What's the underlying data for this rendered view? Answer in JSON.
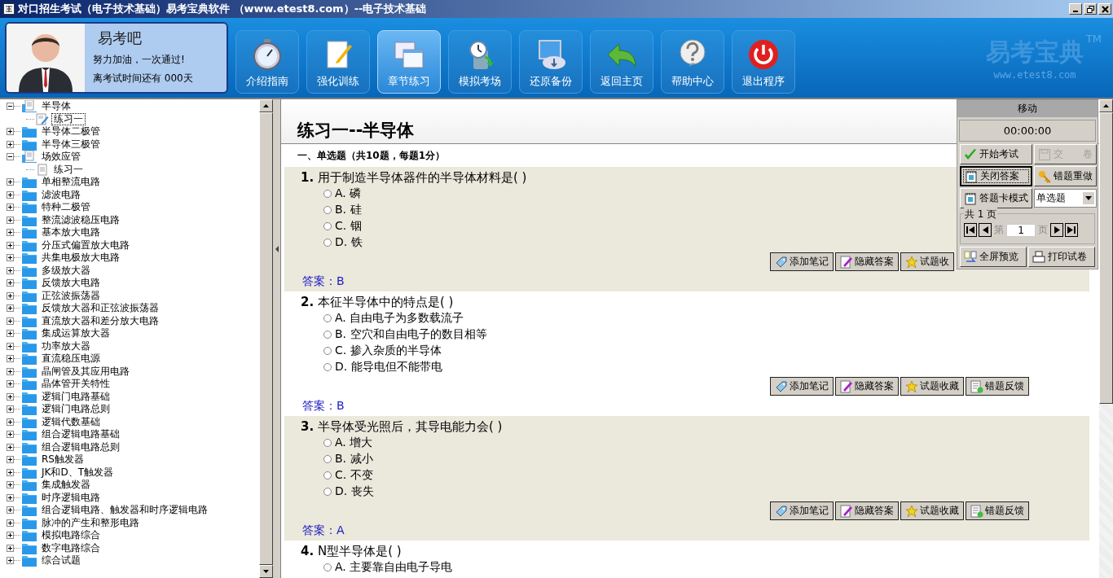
{
  "window": {
    "title": "对口招生考试（电子技术基础）易考宝典软件 （www.etest8.com）--电子技术基础"
  },
  "profile": {
    "name": "易考吧",
    "slogan": "努力加油，一次通过!",
    "countdown": "离考试时间还有 000天"
  },
  "nav": [
    {
      "label": "介绍指南",
      "selected": false
    },
    {
      "label": "强化训练",
      "selected": false
    },
    {
      "label": "章节练习",
      "selected": true
    },
    {
      "label": "模拟考场",
      "selected": false
    },
    {
      "label": "还原备份",
      "selected": false
    },
    {
      "label": "返回主页",
      "selected": false
    },
    {
      "label": "帮助中心",
      "selected": false
    },
    {
      "label": "退出程序",
      "selected": false
    }
  ],
  "logo": {
    "name": "易考宝典",
    "mark": "TM",
    "url": "www.etest8.com"
  },
  "tree": [
    {
      "label": "半导体",
      "expanded": true,
      "children": [
        {
          "label": "练习一",
          "selected": true
        }
      ]
    },
    {
      "label": "半导体二极管",
      "expanded": false
    },
    {
      "label": "半导体三极管",
      "expanded": false
    },
    {
      "label": "场效应管",
      "expanded": true,
      "children": [
        {
          "label": "练习一",
          "selected": false
        }
      ]
    },
    {
      "label": "单相整流电路",
      "expanded": false
    },
    {
      "label": "滤波电路",
      "expanded": false
    },
    {
      "label": "特种二极管",
      "expanded": false
    },
    {
      "label": "整流滤波稳压电路",
      "expanded": false
    },
    {
      "label": "基本放大电路",
      "expanded": false
    },
    {
      "label": "分压式偏置放大电路",
      "expanded": false
    },
    {
      "label": "共集电极放大电路",
      "expanded": false
    },
    {
      "label": "多级放大器",
      "expanded": false
    },
    {
      "label": "反馈放大电路",
      "expanded": false
    },
    {
      "label": "正弦波振荡器",
      "expanded": false
    },
    {
      "label": "反馈放大器和正弦波振荡器",
      "expanded": false
    },
    {
      "label": "直流放大器和差分放大电路",
      "expanded": false
    },
    {
      "label": "集成运算放大器",
      "expanded": false
    },
    {
      "label": "功率放大器",
      "expanded": false
    },
    {
      "label": "直流稳压电源",
      "expanded": false
    },
    {
      "label": "晶闸管及其应用电路",
      "expanded": false
    },
    {
      "label": "晶体管开关特性",
      "expanded": false
    },
    {
      "label": "逻辑门电路基础",
      "expanded": false
    },
    {
      "label": "逻辑门电路总则",
      "expanded": false
    },
    {
      "label": "逻辑代数基础",
      "expanded": false
    },
    {
      "label": "组合逻辑电路基础",
      "expanded": false
    },
    {
      "label": "组合逻辑电路总则",
      "expanded": false
    },
    {
      "label": "RS触发器",
      "expanded": false
    },
    {
      "label": "JK和D、T触发器",
      "expanded": false
    },
    {
      "label": "集成触发器",
      "expanded": false
    },
    {
      "label": "时序逻辑电路",
      "expanded": false
    },
    {
      "label": "组合逻辑电路、触发器和时序逻辑电路",
      "expanded": false
    },
    {
      "label": "脉冲的产生和整形电路",
      "expanded": false
    },
    {
      "label": "模拟电路综合",
      "expanded": false
    },
    {
      "label": "数字电路综合",
      "expanded": false
    },
    {
      "label": "综合试题",
      "expanded": false
    }
  ],
  "exercise": {
    "title": "练习一--半导体",
    "section": "一、单选题（共10题，每题1分）",
    "questions": [
      {
        "number": "1.",
        "text": "用于制造半导体器件的半导体材料是( )",
        "options": [
          {
            "label": "A. 磷",
            "selected": false
          },
          {
            "label": "B. 硅",
            "selected": false
          },
          {
            "label": "C. 铟",
            "selected": false
          },
          {
            "label": "D. 铁",
            "selected": false
          }
        ],
        "actions": [
          "添加笔记",
          "隐藏答案",
          "试题收"
        ],
        "answer": "答案：B"
      },
      {
        "number": "2.",
        "text": "本征半导体中的特点是( )",
        "options": [
          {
            "label": "A. 自由电子为多数载流子",
            "selected": false
          },
          {
            "label": "B. 空穴和自由电子的数目相等",
            "selected": false
          },
          {
            "label": "C. 掺入杂质的半导体",
            "selected": false
          },
          {
            "label": "D. 能导电但不能带电",
            "selected": false
          }
        ],
        "actions": [
          "添加笔记",
          "隐藏答案",
          "试题收藏",
          "错题反馈"
        ],
        "answer": "答案：B"
      },
      {
        "number": "3.",
        "text": "半导体受光照后，其导电能力会( )",
        "options": [
          {
            "label": "A. 增大",
            "selected": false
          },
          {
            "label": "B. 减小",
            "selected": false
          },
          {
            "label": "C. 不变",
            "selected": false
          },
          {
            "label": "D. 丧失",
            "selected": false
          }
        ],
        "actions": [
          "添加笔记",
          "隐藏答案",
          "试题收藏",
          "错题反馈"
        ],
        "answer": "答案：A"
      },
      {
        "number": "4.",
        "text": "N型半导体是( )",
        "options": [
          {
            "label": "A. 主要靠自由电子导电",
            "selected": false
          }
        ]
      }
    ]
  },
  "panel": {
    "title": "移动",
    "timer": "00:00:00",
    "buttons": [
      {
        "label": "开始考试",
        "disabled": false,
        "pressed": false
      },
      {
        "label": "交　　卷",
        "disabled": true,
        "pressed": false
      },
      {
        "label": "关闭答案",
        "disabled": false,
        "pressed": true
      },
      {
        "label": "错题重做",
        "disabled": false,
        "pressed": false
      },
      {
        "label": "答题卡模式",
        "disabled": false,
        "pressed": false
      }
    ],
    "type_select": "单选题",
    "pages": "共 1 页",
    "page_prefix": "第",
    "page": "1",
    "page_suffix": "页",
    "bottom_buttons": [
      "全屏预览",
      "打印试卷"
    ]
  }
}
